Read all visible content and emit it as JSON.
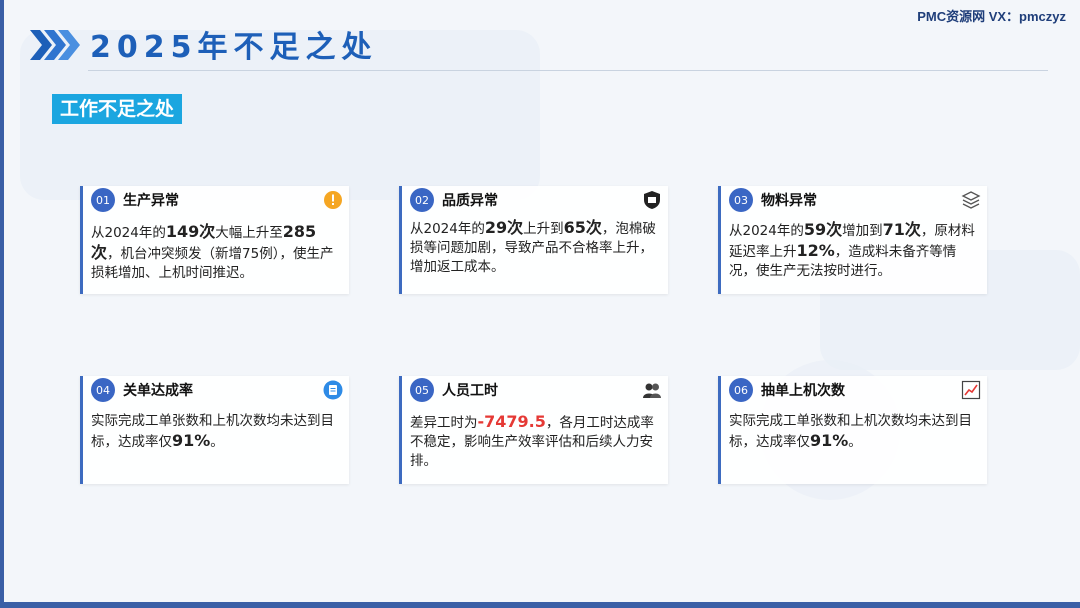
{
  "brand": "PMC资源网 VX：pmczyz",
  "title": "2025年不足之处",
  "section": "工作不足之处",
  "colors": {
    "accent": "#1d5fb8",
    "tag": "#1ba6e0",
    "number": "#3a66c4",
    "highlight": "#e53935"
  },
  "cards": [
    {
      "num": "01",
      "title": "生产异常",
      "icon": "warning-icon",
      "t1": "从2024年的",
      "v1": "149次",
      "t2": "大幅上升至",
      "v2": "285次",
      "t3": "，机台冲突频发（新增75例），使生产损耗增加、上机时间推迟。"
    },
    {
      "num": "02",
      "title": "品质异常",
      "icon": "quality-badge-icon",
      "t1": "从2024年的",
      "v1": "29次",
      "t2": "上升到",
      "v2": "65次",
      "t3": "，泡棉破损等问题加剧，导致产品不合格率上升，增加返工成本。"
    },
    {
      "num": "03",
      "title": "物料异常",
      "icon": "layers-icon",
      "t1": "从2024年的",
      "v1": "59次",
      "t2": "增加到",
      "v2": "71次",
      "t3": "，原材料延迟率上升",
      "v3": "12%",
      "t4": "，造成料未备齐等情况，使生产无法按时进行。"
    },
    {
      "num": "04",
      "title": "关单达成率",
      "icon": "clipboard-icon",
      "t1": "实际完成工单张数和上机次数均未达到目标，达成率仅",
      "v1": "91%",
      "t2": "。"
    },
    {
      "num": "05",
      "title": "人员工时",
      "icon": "people-icon",
      "t1": "差异工时为",
      "v1": "-7479.5",
      "t2": "，各月工时达成率不稳定，影响生产效率评估和后续人力安排。"
    },
    {
      "num": "06",
      "title": "抽单上机次数",
      "icon": "trend-chart-icon",
      "t1": "实际完成工单张数和上机次数均未达到目标，达成率仅",
      "v1": "91%",
      "t2": "。"
    }
  ]
}
